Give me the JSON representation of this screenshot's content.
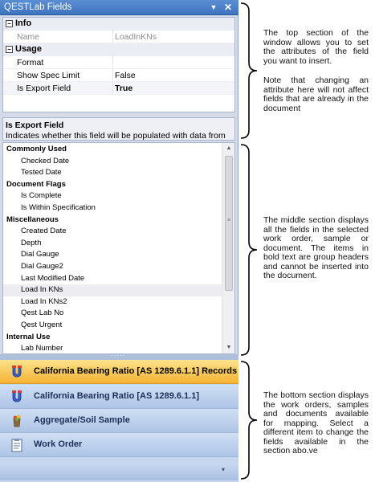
{
  "window": {
    "title": "QESTLab Fields",
    "menu_glyph": "▼",
    "close_glyph": "✕"
  },
  "properties": {
    "categories": [
      {
        "name": "Info",
        "toggle": "−",
        "rows": [
          {
            "name": "Name",
            "value": "LoadInKNs",
            "dim": true
          }
        ]
      },
      {
        "name": "Usage",
        "toggle": "−",
        "rows": [
          {
            "name": "Format",
            "value": ""
          },
          {
            "name": "Show Spec Limit",
            "value": "False"
          },
          {
            "name": "Is Export Field",
            "value": "True",
            "bold": true
          }
        ]
      }
    ]
  },
  "description": {
    "title": "Is Export Field",
    "text": "Indicates whether this field will be populated with data from QESTLab (False), or if the field results are entered by the..."
  },
  "field_list": {
    "items": [
      {
        "label": "Commonly Used",
        "group": true
      },
      {
        "label": "Checked Date"
      },
      {
        "label": "Tested Date"
      },
      {
        "label": "Document Flags",
        "group": true
      },
      {
        "label": "Is Complete"
      },
      {
        "label": "Is Within Specification"
      },
      {
        "label": "Miscellaneous",
        "group": true
      },
      {
        "label": "Created Date"
      },
      {
        "label": "Depth"
      },
      {
        "label": "Dial Gauge"
      },
      {
        "label": "Dial Gauge2"
      },
      {
        "label": "Last Modified Date"
      },
      {
        "label": "Load In KNs",
        "hover": true
      },
      {
        "label": "Load In KNs2"
      },
      {
        "label": "Qest Lab No"
      },
      {
        "label": "Qest Urgent"
      },
      {
        "label": "Internal Use",
        "group": true
      },
      {
        "label": "Lab Number"
      }
    ],
    "scroll_up": "▲",
    "scroll_down": "▼",
    "thumb_grip": "≡"
  },
  "splitter": {
    "grip": "·····"
  },
  "navigator": {
    "items": [
      {
        "label": "California Bearing Ratio [AS 1289.6.1.1] Records",
        "icon": "cbr-records-icon",
        "active": true
      },
      {
        "label": "California Bearing Ratio [AS 1289.6.1.1]",
        "icon": "cbr-icon"
      },
      {
        "label": "Aggregate/Soil Sample",
        "icon": "sample-icon"
      },
      {
        "label": "Work Order",
        "icon": "work-order-icon"
      }
    ],
    "overflow_glyph": "▾"
  },
  "annotations": {
    "top": "The top section of the window allows you to set the attributes of the field you want to insert.",
    "top_note": "Note that changing an attribute here will not affect fields that are already in the document",
    "middle": "The middle section displays all the fields in the selected work order, sample or document. The items in bold text are group headers and cannot be inserted into the document.",
    "bottom": "The bottom section displays the work orders, samples and documents available for mapping. Select a different item to change the fields available in the section abo.ve"
  },
  "colors": {
    "title_bar": "#3e73bf",
    "active_item": "#f5b233",
    "navigator": "#c5d6ee"
  }
}
